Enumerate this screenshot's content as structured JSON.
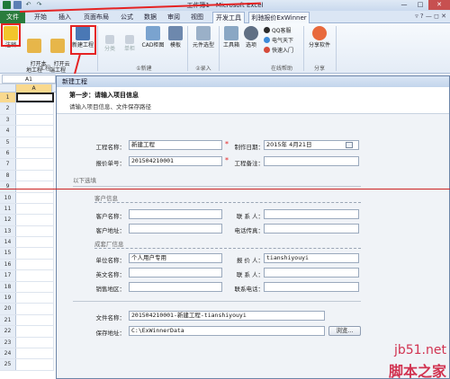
{
  "window": {
    "title": "工作簿1 - Microsoft Excel",
    "controls": [
      "—",
      "□",
      "✕"
    ]
  },
  "tabs": [
    "文件",
    "开始",
    "插入",
    "页面布局",
    "公式",
    "数据",
    "审阅",
    "视图",
    "开发工具",
    "利驰报价ExWinner"
  ],
  "ribbon": {
    "buttons": [
      {
        "label": "注销"
      },
      {
        "label": "打开本\n地工程"
      },
      {
        "label": "打开云\n端工程"
      },
      {
        "label": "新建工程"
      },
      {
        "label": "分类"
      },
      {
        "label": "单柜"
      },
      {
        "label": "CAD柜图"
      },
      {
        "label": "模板"
      },
      {
        "label": "元件选型"
      },
      {
        "label": "工具箱"
      },
      {
        "label": "选项"
      },
      {
        "label": "QQ客服"
      },
      {
        "label": "电气天下"
      },
      {
        "label": "快速入门"
      },
      {
        "label": "分享软件"
      }
    ],
    "groups": [
      "工程",
      "①新建",
      "②录入",
      "在线帮助",
      "分享"
    ],
    "colors": {
      "accent_red": "#e52323",
      "file_tab": "#2a7c3d"
    }
  },
  "namebox": "A1",
  "column_header": "A",
  "rows": [
    "1",
    "2",
    "3",
    "4",
    "5",
    "6",
    "7",
    "8",
    "9",
    "10",
    "11",
    "12",
    "13",
    "14",
    "15",
    "16",
    "17",
    "18",
    "19",
    "20",
    "21",
    "22",
    "23",
    "24",
    "25"
  ],
  "dialog": {
    "title": "新建工程",
    "step_title": "第一步：请输入项目信息",
    "step_desc": "请输入项目信息、文件保存路径",
    "fields": {
      "project_name_label": "工程名称：",
      "project_name": "新建工程",
      "date_label": "制作日期：",
      "date": "2015年 4月21日",
      "quote_no_label": "报价单号：",
      "quote_no": "201504210001",
      "note_label": "工程备注：",
      "note": ""
    },
    "optional_label": "以下选填",
    "customer_section": "客户信息",
    "customer": {
      "name_label": "客户名称：",
      "contact_label": "联 系 人：",
      "address_label": "客户地址：",
      "phone_label": "电话传真："
    },
    "maker_section": "成套厂信息",
    "maker": {
      "unit_label": "单位名称：",
      "unit": "个人用户专用",
      "quoter_label": "报 价 人：",
      "quoter": "tianshiyouyi",
      "en_name_label": "英文名称：",
      "contact_label": "联 系 人：",
      "region_label": "销售地区：",
      "phone_label": "联系电话："
    },
    "file": {
      "file_name_label": "文件名称：",
      "file_name": "201504210001-新建工程-tianshiyouyi",
      "path_label": "保存地址：",
      "path": "C:\\ExWinnerData",
      "browse": "浏览..."
    }
  },
  "watermark": {
    "site": "jb51.net",
    "brand": "脚本之家"
  }
}
